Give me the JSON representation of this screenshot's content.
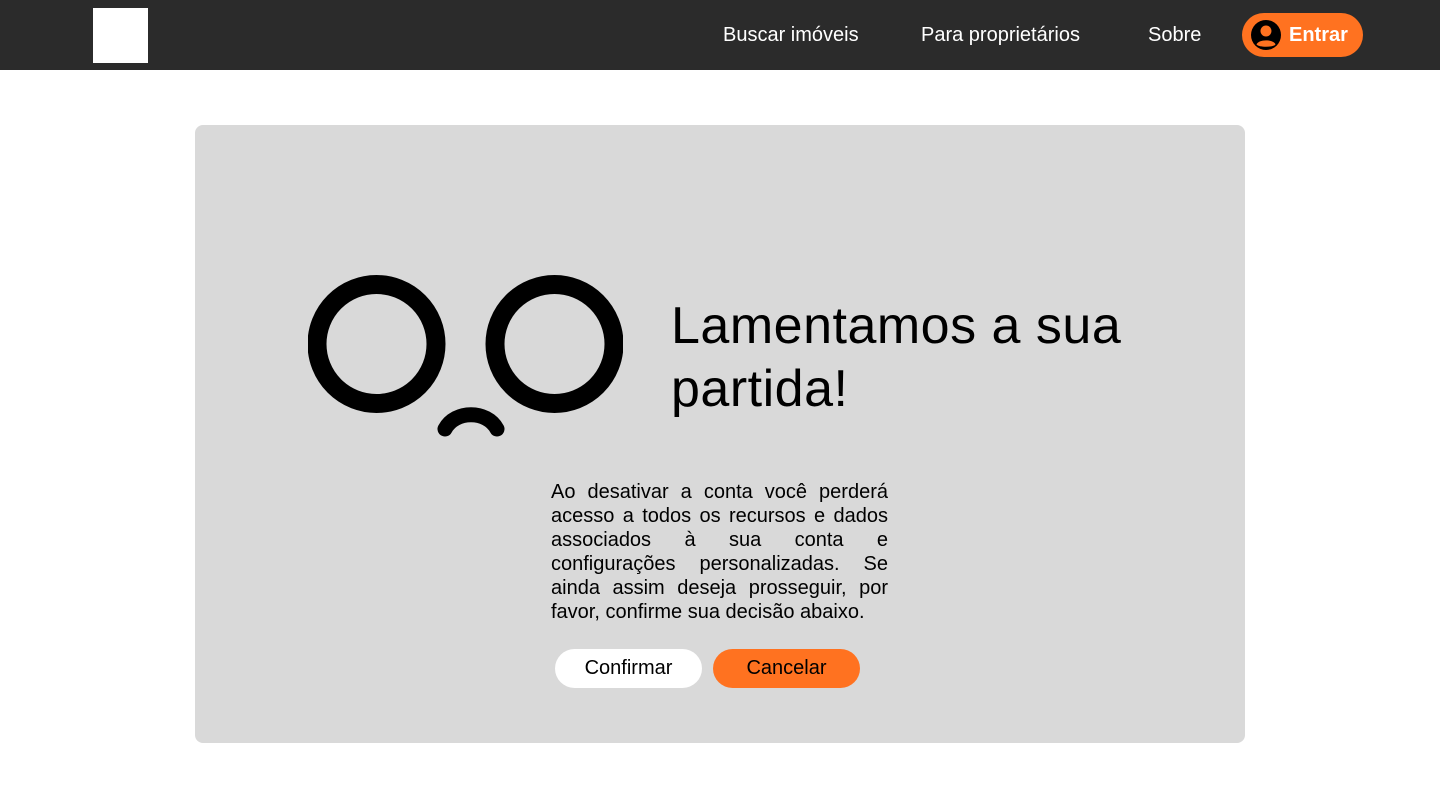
{
  "header": {
    "nav": {
      "search_label": "Buscar imóveis",
      "owners_label": "Para proprietários",
      "about_label": "Sobre"
    },
    "login_label": "Entrar",
    "login_icon": "user-icon"
  },
  "dialog": {
    "illustration_icon": "sad-face-icon",
    "title": "Lamentamos a sua partida!",
    "message": "Ao desativar a conta você perderá acesso a todos os recursos e dados associados à sua conta e configurações personalizadas. Se ainda assim deseja prosseguir, por favor, confirme sua decisão abaixo.",
    "confirm_label": "Confirmar",
    "cancel_label": "Cancelar"
  },
  "colors": {
    "topbar": "#2b2b2b",
    "accent": "#ff7220",
    "card": "#d9d9d9"
  }
}
